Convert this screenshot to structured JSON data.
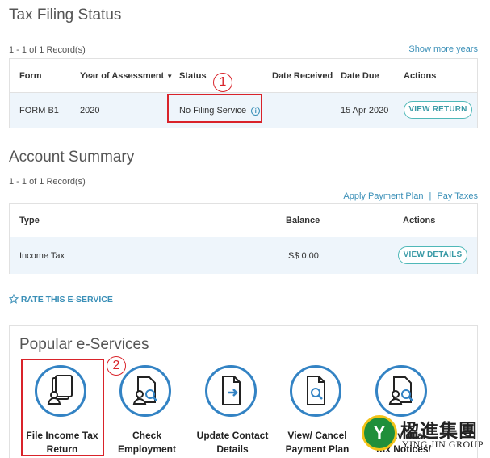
{
  "tax_filing": {
    "title": "Tax Filing Status",
    "records": "1 - 1 of 1 Record(s)",
    "show_more": "Show more years",
    "headers": {
      "form": "Form",
      "year": "Year of Assessment",
      "sort": "▼",
      "status": "Status",
      "received": "Date Received",
      "due": "Date Due",
      "actions": "Actions"
    },
    "row": {
      "form": "FORM B1",
      "year": "2020",
      "status": "No Filing Service",
      "info": "i",
      "received": "",
      "due": "15 Apr 2020",
      "action": "VIEW RETURN"
    },
    "marker": "1"
  },
  "account": {
    "title": "Account Summary",
    "records": "1 - 1 of 1 Record(s)",
    "apply_plan": "Apply Payment Plan",
    "separator": "|",
    "pay_taxes": "Pay Taxes",
    "headers": {
      "type": "Type",
      "balance": "Balance",
      "actions": "Actions"
    },
    "row": {
      "type": "Income Tax",
      "balance": "S$ 0.00",
      "action": "VIEW DETAILS"
    }
  },
  "rate": {
    "label": "RATE THIS E-SERVICE",
    "icon": "star-outline-icon"
  },
  "popular": {
    "title": "Popular e-Services",
    "marker": "2",
    "services": [
      {
        "line1": "File Income Tax",
        "line2": "Return",
        "icon": "file-person-icon"
      },
      {
        "line1": "Check",
        "line2": "Employment",
        "icon": "document-search-person-icon"
      },
      {
        "line1": "Update Contact",
        "line2": "Details",
        "icon": "document-arrow-icon"
      },
      {
        "line1": "View/ Cancel",
        "line2": "Payment Plan",
        "icon": "document-search-icon"
      },
      {
        "line1": "Individual",
        "line2": "Tax Notices/",
        "icon": "document-search-person-icon"
      }
    ]
  },
  "watermark": {
    "chinese": "楹進集團",
    "english": "YING JIN GROUP",
    "logo_letter": "Y"
  },
  "colors": {
    "accent": "#3a8fb7",
    "teal": "#4fb8b8",
    "red": "#d9232a",
    "icon_blue": "#3383c4",
    "logo_green": "#1f8f3a"
  }
}
